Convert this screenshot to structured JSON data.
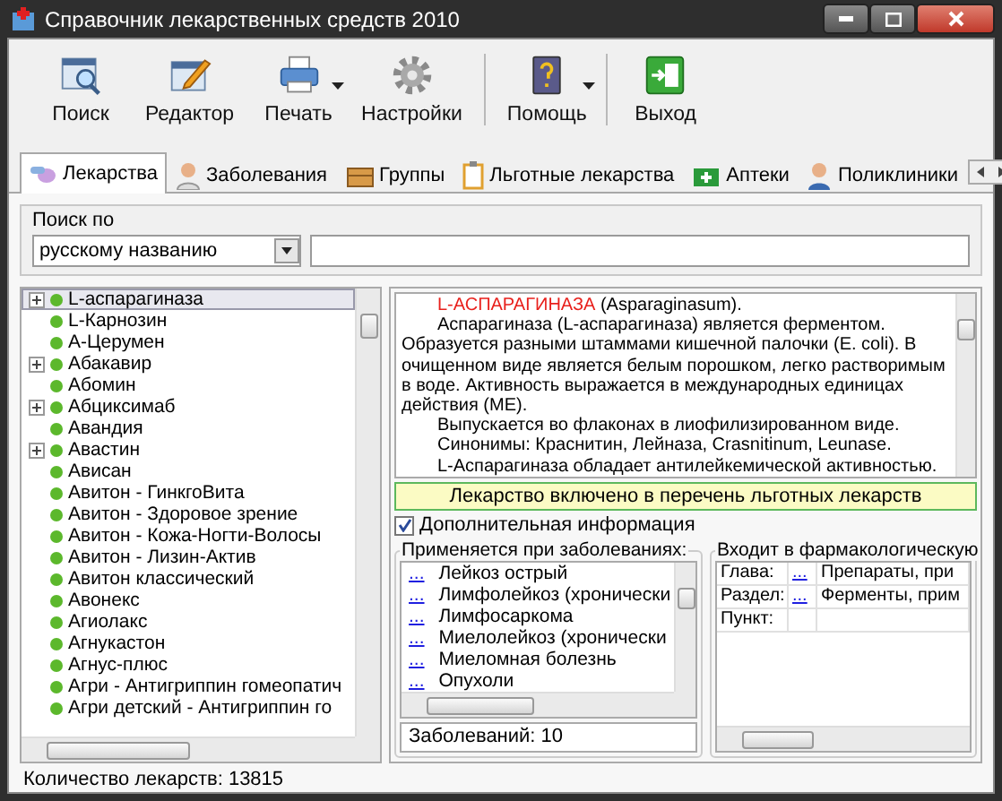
{
  "window": {
    "title": "Справочник лекарственных средств 2010"
  },
  "toolbar": {
    "groups": [
      [
        {
          "label": "Поиск",
          "dropdown": false
        },
        {
          "label": "Редактор",
          "dropdown": false
        },
        {
          "label": "Печать",
          "dropdown": true
        },
        {
          "label": "Настройки",
          "dropdown": false
        }
      ],
      [
        {
          "label": "Помощь",
          "dropdown": true
        }
      ],
      [
        {
          "label": "Выход",
          "dropdown": false
        }
      ]
    ]
  },
  "tabs": [
    {
      "label": "Лекарства",
      "selected": true
    },
    {
      "label": "Заболевания",
      "selected": false
    },
    {
      "label": "Группы",
      "selected": false
    },
    {
      "label": "Льготные лекарства",
      "selected": false
    },
    {
      "label": "Аптеки",
      "selected": false
    },
    {
      "label": "Поликлиники",
      "selected": false
    }
  ],
  "search": {
    "label": "Поиск по",
    "mode": "русскому названию"
  },
  "drugs": [
    {
      "label": "L-аспарагиназа",
      "expandable": true,
      "selected": true
    },
    {
      "label": "L-Карнозин",
      "expandable": false,
      "selected": false
    },
    {
      "label": "А-Церумен",
      "expandable": false,
      "selected": false
    },
    {
      "label": "Абакавир",
      "expandable": true,
      "selected": false
    },
    {
      "label": "Абомин",
      "expandable": false,
      "selected": false
    },
    {
      "label": "Абциксимаб",
      "expandable": true,
      "selected": false
    },
    {
      "label": "Авандия",
      "expandable": false,
      "selected": false
    },
    {
      "label": "Авастин",
      "expandable": true,
      "selected": false
    },
    {
      "label": "Ависан",
      "expandable": false,
      "selected": false
    },
    {
      "label": "Авитон - ГинкгоВита",
      "expandable": false,
      "selected": false
    },
    {
      "label": "Авитон - Здоровое зрение",
      "expandable": false,
      "selected": false
    },
    {
      "label": "Авитон - Кожа-Ногти-Волосы",
      "expandable": false,
      "selected": false
    },
    {
      "label": "Авитон - Лизин-Актив",
      "expandable": false,
      "selected": false
    },
    {
      "label": "Авитон классический",
      "expandable": false,
      "selected": false
    },
    {
      "label": "Авонекс",
      "expandable": false,
      "selected": false
    },
    {
      "label": "Агиолакс",
      "expandable": false,
      "selected": false
    },
    {
      "label": "Агнукастон",
      "expandable": false,
      "selected": false
    },
    {
      "label": "Агнус-плюс",
      "expandable": false,
      "selected": false
    },
    {
      "label": "Агри - Антигриппин гомеопатич",
      "expandable": false,
      "selected": false
    },
    {
      "label": "Агри детский - Антигриппин го",
      "expandable": false,
      "selected": false
    }
  ],
  "drug_count": "Количество лекарств: 13815",
  "description": {
    "title": "L-АСПАРАГИНАЗА",
    "title_latin": "(Asparaginasum).",
    "paragraphs": [
      "Аспарагиназа (L-аспарагиназа) является ферментом. Образуется разными штаммами кишечной палочки (E. coli). В очищенном виде является белым порошком, легко растворимым в воде. Активность выражается в международных единицах действия (МЕ).",
      "Выпускается во флаконах в лиофилизированном виде.",
      "Синонимы: Краснитин, Лейназа, Crasnitinum, Leunase.",
      "L-Аспарагиназа обладает антилейкемической активностью."
    ]
  },
  "banner": "Лекарство включено в перечень льготных лекарств",
  "extra_info": {
    "label": "Дополнительная информация",
    "checked": true
  },
  "diseases": {
    "title": "Применяется при заболеваниях:",
    "rows": [
      {
        "link": "...",
        "name": "Лейкоз острый"
      },
      {
        "link": "...",
        "name": "Лимфолейкоз (хронически"
      },
      {
        "link": "...",
        "name": "Лимфосаркома"
      },
      {
        "link": "...",
        "name": "Миелолейкоз (хронически"
      },
      {
        "link": "...",
        "name": "Миеломная болезнь"
      },
      {
        "link": "...",
        "name": "Опухоли"
      }
    ],
    "count": "Заболеваний: 10"
  },
  "pharm_group": {
    "title": "Входит в фармакологическую",
    "rows": [
      {
        "label": "Глава:",
        "link": "...",
        "value": "Препараты, при"
      },
      {
        "label": "Раздел:",
        "link": "...",
        "value": "Ферменты, прим"
      },
      {
        "label": "Пункт:"
      }
    ]
  }
}
